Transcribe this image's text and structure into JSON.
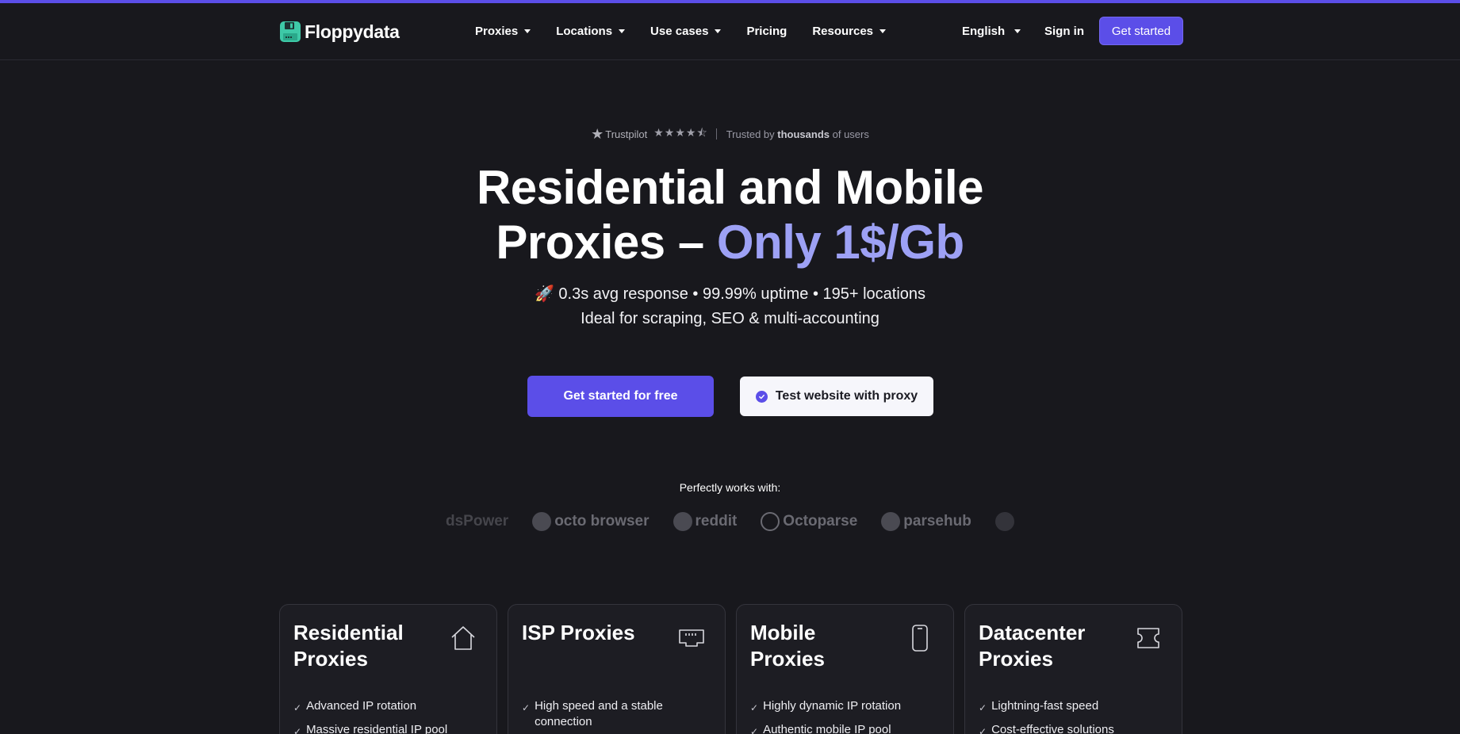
{
  "header": {
    "logo_text": "Floppydata",
    "nav": [
      {
        "label": "Proxies",
        "dropdown": true
      },
      {
        "label": "Locations",
        "dropdown": true
      },
      {
        "label": "Use cases",
        "dropdown": true
      },
      {
        "label": "Pricing",
        "dropdown": false
      },
      {
        "label": "Resources",
        "dropdown": true
      }
    ],
    "language": "English",
    "sign_in": "Sign in",
    "get_started": "Get started"
  },
  "hero": {
    "trust_brand": "Trustpilot",
    "trust_rating": 4.5,
    "trust_prefix": "Trusted by ",
    "trust_bold": "thousands",
    "trust_suffix": " of users",
    "title_line1": "Residential and Mobile",
    "title_line2_start": "Proxies – ",
    "title_line2_accent": "Only 1$/Gb",
    "sub_line1": "🚀 0.3s avg response • 99.99% uptime • 195+ locations",
    "sub_line2": "Ideal for scraping, SEO & multi-accounting",
    "cta_primary": "Get started for free",
    "cta_secondary": "Test website with proxy"
  },
  "partners": {
    "heading": "Perfectly works with:",
    "logos": [
      "dsPower",
      "octo browser",
      "reddit",
      "Octoparse",
      "parsehub"
    ]
  },
  "cards": [
    {
      "title": "Residential Proxies",
      "icon": "house-icon",
      "features": [
        "Advanced IP rotation",
        "Massive residential IP pool"
      ]
    },
    {
      "title": "ISP Proxies",
      "icon": "ethernet-port-icon",
      "features": [
        "High speed and a stable connection"
      ]
    },
    {
      "title": "Mobile Proxies",
      "icon": "smartphone-icon",
      "features": [
        "Highly dynamic IP rotation",
        "Authentic mobile IP pool"
      ]
    },
    {
      "title": "Datacenter Proxies",
      "icon": "ticket-icon",
      "features": [
        "Lightning-fast speed",
        "Cost-effective solutions"
      ]
    }
  ],
  "colors": {
    "accent": "#5b4ee8",
    "accent_text": "#9da1f5",
    "background": "#18181d",
    "logo_green": "#3ec9a7"
  }
}
